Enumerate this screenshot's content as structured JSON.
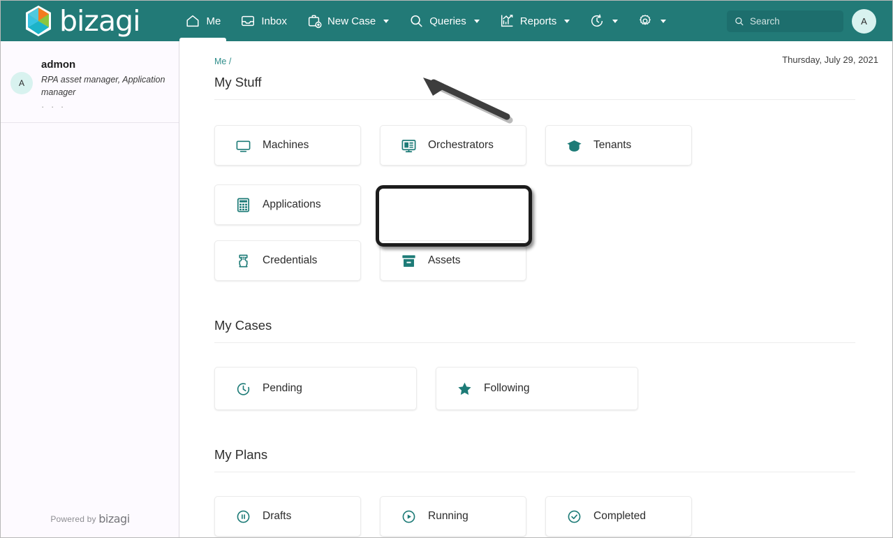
{
  "brand": {
    "name": "bizagi",
    "logo_icon": "bizagi-hex-logo",
    "accent": "#227a77",
    "teal_icon": "#1d7b77"
  },
  "topnav": {
    "items": [
      {
        "label": "Me",
        "icon": "home-icon",
        "active": true,
        "caret": false
      },
      {
        "label": "Inbox",
        "icon": "inbox-tray-icon",
        "active": false,
        "caret": false
      },
      {
        "label": "New Case",
        "icon": "briefcase-plus-icon",
        "active": false,
        "caret": true
      },
      {
        "label": "Queries",
        "icon": "search-icon",
        "active": false,
        "caret": true
      },
      {
        "label": "Reports",
        "icon": "bar-chart-icon",
        "active": false,
        "caret": true
      },
      {
        "label": "",
        "icon": "clock-refresh-icon",
        "active": false,
        "caret": true
      },
      {
        "label": "",
        "icon": "gear-icon",
        "active": false,
        "caret": true
      }
    ],
    "search": {
      "placeholder": "Search",
      "icon": "search-icon"
    },
    "avatar": {
      "initial": "A"
    }
  },
  "sidebar": {
    "user": {
      "avatar_initial": "A",
      "name": "admon",
      "role": "RPA asset manager, Application manager",
      "more": "· · ·"
    },
    "footer": {
      "prefix": "Powered by",
      "brand": "bizagi"
    }
  },
  "main": {
    "breadcrumb": "Me /",
    "date": "Thursday, July 29, 2021",
    "sections": [
      {
        "title": "My Stuff",
        "rows": [
          [
            {
              "label": "Machines",
              "icon": "monitor-icon"
            },
            {
              "label": "Orchestrators",
              "icon": "server-monitor-icon"
            },
            {
              "label": "Tenants",
              "icon": "graduation-cap-icon"
            },
            {
              "label": "Applications",
              "icon": "calculator-grid-icon"
            }
          ],
          [
            {
              "label": "Credentials",
              "icon": "badge-ticket-icon"
            },
            {
              "label": "Assets",
              "icon": "archive-box-icon",
              "highlighted": true
            }
          ]
        ]
      },
      {
        "title": "My Cases",
        "rows": [
          [
            {
              "label": "Pending",
              "icon": "clock-icon"
            },
            {
              "label": "Following",
              "icon": "star-icon"
            }
          ]
        ]
      },
      {
        "title": "My Plans",
        "rows": [
          [
            {
              "label": "Drafts",
              "icon": "pause-circle-icon"
            },
            {
              "label": "Running",
              "icon": "play-circle-icon"
            },
            {
              "label": "Completed",
              "icon": "check-circle-icon"
            }
          ]
        ]
      }
    ]
  },
  "annotations": {
    "arrow": {
      "target": "me-tab",
      "color": "#3d3d3d"
    },
    "highlight": {
      "target": "Assets",
      "color": "#1c1c1c"
    }
  }
}
